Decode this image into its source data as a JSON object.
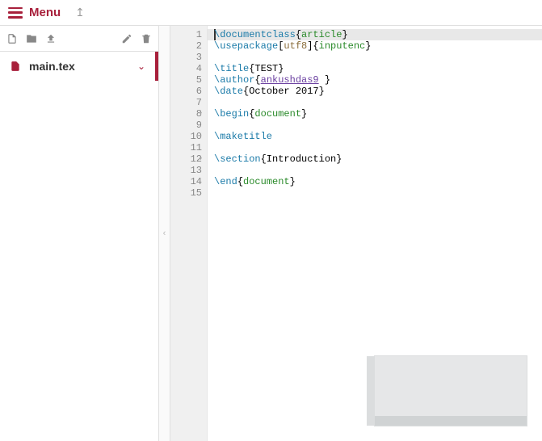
{
  "header": {
    "menu_label": "Menu"
  },
  "sidebar": {
    "files": [
      {
        "name": "main.tex",
        "active": true
      }
    ]
  },
  "editor": {
    "lines": [
      {
        "n": 1,
        "hl": true,
        "fold": false,
        "tokens": [
          [
            "cursor",
            ""
          ],
          [
            "kw",
            "\\documentclass"
          ],
          [
            "",
            "{"
          ],
          [
            "type",
            "article"
          ],
          [
            "",
            "}"
          ]
        ]
      },
      {
        "n": 2,
        "hl": false,
        "fold": false,
        "tokens": [
          [
            "kw",
            "\\usepackage"
          ],
          [
            "",
            "["
          ],
          [
            "str",
            "utf8"
          ],
          [
            "",
            "]{"
          ],
          [
            "type",
            "inputenc"
          ],
          [
            "",
            "}"
          ]
        ]
      },
      {
        "n": 3,
        "hl": false,
        "fold": false,
        "tokens": [
          [
            "",
            ""
          ]
        ]
      },
      {
        "n": 4,
        "hl": false,
        "fold": false,
        "tokens": [
          [
            "kw",
            "\\title"
          ],
          [
            "",
            "{TEST}"
          ]
        ]
      },
      {
        "n": 5,
        "hl": false,
        "fold": false,
        "tokens": [
          [
            "kw",
            "\\author"
          ],
          [
            "",
            "{"
          ],
          [
            "var",
            "ankushdas9"
          ],
          [
            "",
            " }"
          ]
        ]
      },
      {
        "n": 6,
        "hl": false,
        "fold": false,
        "tokens": [
          [
            "kw",
            "\\date"
          ],
          [
            "",
            "{October 2017}"
          ]
        ]
      },
      {
        "n": 7,
        "hl": false,
        "fold": false,
        "tokens": [
          [
            "",
            ""
          ]
        ]
      },
      {
        "n": 8,
        "hl": false,
        "fold": true,
        "tokens": [
          [
            "kw",
            "\\begin"
          ],
          [
            "",
            "{"
          ],
          [
            "type",
            "document"
          ],
          [
            "",
            "}"
          ]
        ]
      },
      {
        "n": 9,
        "hl": false,
        "fold": false,
        "tokens": [
          [
            "",
            ""
          ]
        ]
      },
      {
        "n": 10,
        "hl": false,
        "fold": false,
        "tokens": [
          [
            "kw",
            "\\maketitle"
          ]
        ]
      },
      {
        "n": 11,
        "hl": false,
        "fold": false,
        "tokens": [
          [
            "",
            ""
          ]
        ]
      },
      {
        "n": 12,
        "hl": false,
        "fold": true,
        "tokens": [
          [
            "kw",
            "\\section"
          ],
          [
            "",
            "{Introduction}"
          ]
        ]
      },
      {
        "n": 13,
        "hl": false,
        "fold": false,
        "tokens": [
          [
            "",
            ""
          ]
        ]
      },
      {
        "n": 14,
        "hl": false,
        "fold": false,
        "tokens": [
          [
            "kw",
            "\\end"
          ],
          [
            "",
            "{"
          ],
          [
            "type",
            "document"
          ],
          [
            "",
            "}"
          ]
        ]
      },
      {
        "n": 15,
        "hl": false,
        "fold": false,
        "tokens": [
          [
            "",
            ""
          ]
        ]
      }
    ]
  }
}
